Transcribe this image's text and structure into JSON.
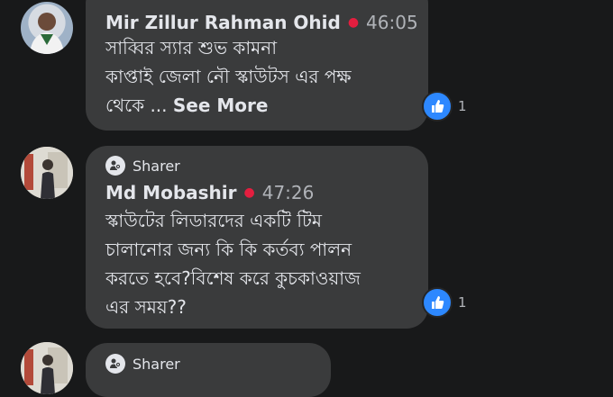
{
  "comments": [
    {
      "author": "Mir Zillur Rahman Ohid",
      "time": "46:05",
      "lines": [
        "সাব্বির স্যার শুভ কামনা",
        "কাপ্তাই জেলা নৌ স্কাউটস এর পক্ষ",
        "থেকে ..."
      ],
      "see_more": "See More",
      "likes": "1"
    },
    {
      "badge": "Sharer",
      "author": "Md Mobashir",
      "time": "47:26",
      "lines": [
        "স্কাউটের লিডারদের একটি টিম",
        "চালানোর জন্য কি কি কর্তব্য পালন",
        "করতে হবে?বিশেষ করে কুচকাওয়াজ",
        "এর সময়??"
      ],
      "likes": "1"
    },
    {
      "badge": "Sharer"
    }
  ],
  "colors": {
    "bubble": "#3a3b3c",
    "background": "#18191a",
    "like_blue": "#2d88ff",
    "live_dot": "#e41e3f"
  }
}
